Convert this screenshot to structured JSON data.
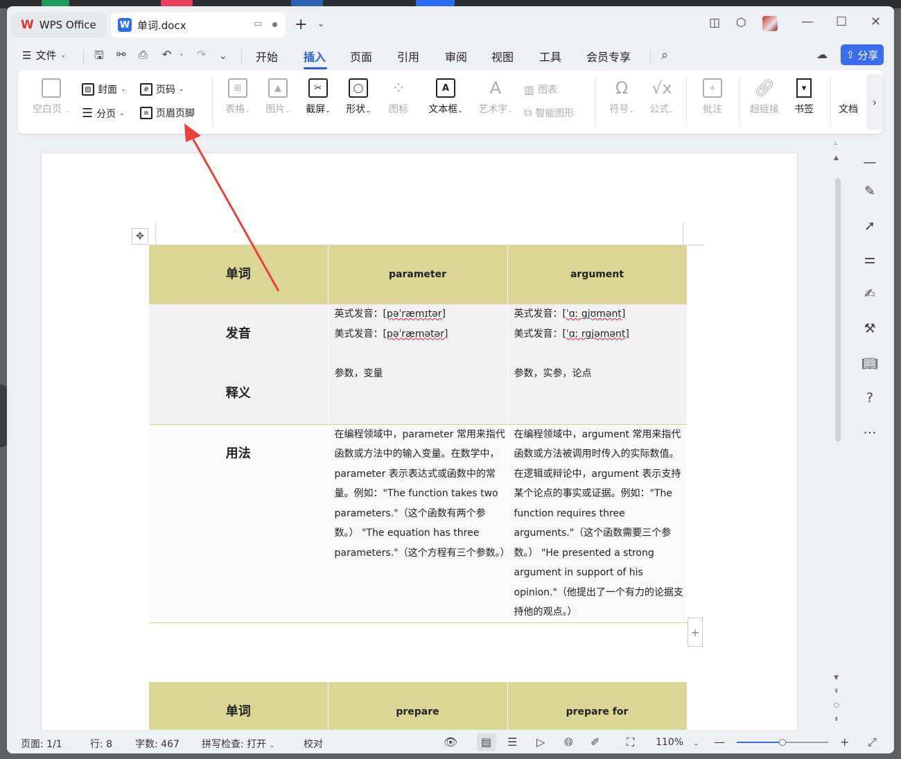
{
  "tabs": {
    "app_label": "WPS Office",
    "doc_logo": "W",
    "doc_title": "单词.docx"
  },
  "menu": {
    "file": "文件",
    "items": [
      "开始",
      "插入",
      "页面",
      "引用",
      "审阅",
      "视图",
      "工具",
      "会员专享"
    ],
    "active": "插入",
    "share": "分享"
  },
  "ribbon": {
    "blank_page": "空白页",
    "cover": "封面",
    "page_num": "页码",
    "page_break": "分页",
    "header_footer": "页眉页脚",
    "table": "表格",
    "picture": "图片",
    "screenshot": "截屏",
    "shape": "形状",
    "icon": "图标",
    "textbox": "文本框",
    "wordart": "艺术字",
    "chart": "图表",
    "smart_shape": "智能图形",
    "symbol": "符号",
    "formula": "公式",
    "comment": "批注",
    "hyperlink": "超链接",
    "bookmark": "书签",
    "doc_more": "文档"
  },
  "table1": {
    "header": [
      "单词",
      "parameter",
      "argument"
    ],
    "pron_label": "发音",
    "pron": [
      {
        "uk_label": "英式发音：",
        "uk": "[pəˈræmɪtər]",
        "us_label": "美式发音：",
        "us": "[pəˈræmətər]"
      },
      {
        "uk_label": "英式发音：",
        "uk": "[ˈɑː gjʊmənt]",
        "us_label": "美式发音：",
        "us": "[ˈɑː rgjəmənt]"
      }
    ],
    "def_label": "释义",
    "defs": [
      "参数，变量",
      "参数，实参，论点"
    ],
    "use_label": "用法",
    "usage": [
      "在编程领域中，parameter 常用来指代函数或方法中的输入变量。在数学中，parameter 表示表达式或函数中的常量。例如：\"The function takes two parameters.\"（这个函数有两个参数。） \"The equation has three parameters.\"（这个方程有三个参数。）",
      "在编程领域中，argument 常用来指代函数或方法被调用时传入的实际数值。在逻辑或辩论中，argument 表示支持某个论点的事实或证据。例如：\"The function requires three arguments.\"（这个函数需要三个参数。） \"He presented a strong argument in support of his opinion.\"（他提出了一个有力的论据支持他的观点。）"
    ]
  },
  "table2": {
    "header": [
      "单词",
      "prepare",
      "prepare for"
    ]
  },
  "status": {
    "page": "页面: 1/1",
    "line": "行: 8",
    "words": "字数: 467",
    "spell": "拼写检查: 打开",
    "proof": "校对",
    "zoom": "110%",
    "zoom_level": 0.5
  },
  "colors": {
    "accent": "#2a5fd8",
    "header_fill": "#dbd695",
    "arrow": "#e8403a"
  }
}
